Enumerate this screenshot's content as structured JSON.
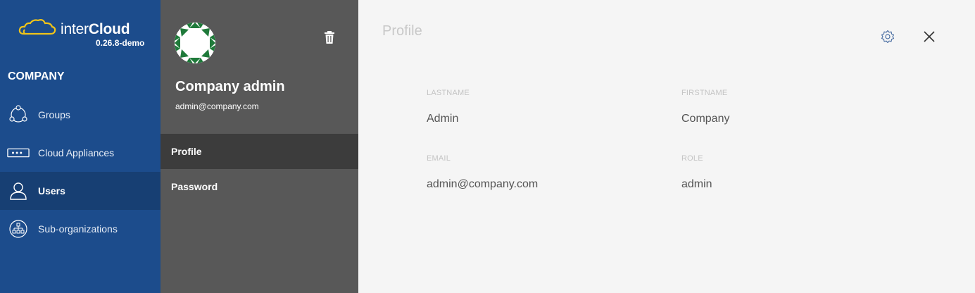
{
  "brand": {
    "name_light": "inter",
    "name_bold": "Cloud",
    "version": "0.26.8-demo",
    "accent": "#f0c419"
  },
  "sidebar": {
    "section_title": "COMPANY",
    "items": [
      {
        "label": "Groups",
        "icon": "groups-icon"
      },
      {
        "label": "Cloud Appliances",
        "icon": "appliance-icon"
      },
      {
        "label": "Users",
        "icon": "user-icon",
        "active": true
      },
      {
        "label": "Sub-organizations",
        "icon": "org-tree-icon"
      }
    ]
  },
  "user": {
    "name": "Company admin",
    "email": "admin@company.com"
  },
  "subnav": {
    "items": [
      {
        "label": "Profile",
        "active": true
      },
      {
        "label": "Password"
      }
    ]
  },
  "content": {
    "title": "Profile",
    "fields": [
      {
        "label": "LASTNAME",
        "value": "Admin"
      },
      {
        "label": "FIRSTNAME",
        "value": "Company"
      },
      {
        "label": "EMAIL",
        "value": "admin@company.com"
      },
      {
        "label": "ROLE",
        "value": "admin"
      }
    ]
  },
  "colors": {
    "sidebar": "#1c4c8c",
    "sidebar_active": "#173f73",
    "middle": "#585858",
    "middle_active": "#3c3c3c",
    "avatar_green": "#1f7a3a"
  }
}
